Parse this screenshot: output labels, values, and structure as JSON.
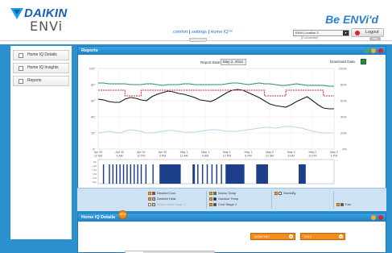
{
  "header": {
    "brand_daikin": "DAIKIN",
    "brand_envi": "ENVi",
    "brand_right": "Be ENVi'd",
    "nav": {
      "comfort": "comfort",
      "sep1": " | ",
      "settings": "settings",
      "sep2": " | ",
      "home_iq": "Home IQ™"
    },
    "zone_select": "ENVi Location 3",
    "zone_sub": "(2 connected)",
    "logout": "Logout",
    "help": "help"
  },
  "sidebar": {
    "items": [
      {
        "label": "Home IQ Details"
      },
      {
        "label": "Home IQ Insights"
      },
      {
        "label": "Reports"
      }
    ]
  },
  "reports": {
    "title": "Reports",
    "report_date_label": "Report Date:",
    "report_date_value": "May 2, 2013",
    "download_label": "Download Data"
  },
  "chart_data": {
    "type": "line",
    "x_ticks": [
      "Apr 30\n12 AM",
      "Apr 30\n6 AM",
      "Apr 30\n12 PM",
      "Apr 30\n6 PM",
      "May 1\n12 AM",
      "May 1\n6 AM",
      "May 1\n12 PM",
      "May 1\n6 PM",
      "May 2\n12 AM",
      "May 2\n6 AM",
      "May 2\n12 PM",
      "May 2\n6 PM"
    ],
    "y_left_ticks": [
      "100°",
      "80°",
      "60°",
      "40°",
      "20°",
      "0°"
    ],
    "y_right_ticks": [
      "100%",
      "80%",
      "60%",
      "40%",
      "20%",
      "0%"
    ],
    "ylim": [
      0,
      100
    ],
    "series": [
      {
        "name": "Outdoor Temp",
        "color": "#1a1a1a",
        "values": [
          62,
          61,
          59,
          58,
          58,
          62,
          64,
          63,
          61,
          60,
          65,
          68,
          70,
          72,
          71,
          69,
          68,
          66,
          64,
          61,
          60,
          59,
          62,
          66,
          70,
          73,
          74,
          73,
          70,
          67,
          64,
          60,
          56,
          54,
          53,
          52,
          55,
          59,
          62,
          65,
          60,
          55,
          51,
          50,
          50
        ]
      },
      {
        "name": "Indoor Temp",
        "color": "#2e8b7a",
        "values": [
          82,
          82,
          81,
          81,
          81,
          81,
          80,
          80,
          80,
          81,
          81,
          80,
          79,
          80,
          80,
          80,
          81,
          81,
          80,
          80,
          80,
          80,
          80,
          80,
          81,
          82,
          82,
          81,
          80,
          81,
          82,
          81,
          81,
          80,
          79,
          79,
          80,
          81,
          80,
          79,
          79,
          79,
          79,
          78,
          78
        ]
      },
      {
        "name": "Desired Cool",
        "color": "#d42f2f",
        "values": [
          73,
          73,
          73,
          73,
          73,
          66,
          66,
          66,
          73,
          73,
          73,
          73,
          73,
          73,
          73,
          73,
          73,
          73,
          73,
          73,
          73,
          73,
          73,
          73,
          73,
          73,
          73,
          73,
          73,
          73,
          73,
          66,
          66,
          66,
          66,
          73,
          73,
          73,
          73,
          73,
          73,
          73,
          66,
          66,
          66
        ]
      },
      {
        "name": "Humidity",
        "color": "#b9d3ee",
        "values": [
          20,
          21,
          22,
          21,
          20,
          22,
          24,
          23,
          22,
          20,
          20,
          21,
          22,
          23,
          23,
          22,
          21,
          21,
          21,
          22,
          23,
          24,
          24,
          23,
          22,
          22,
          22,
          23,
          24,
          25,
          26,
          27,
          27,
          26,
          27,
          28,
          28,
          27,
          26,
          24,
          22,
          21,
          20,
          20,
          20
        ]
      }
    ],
    "bottom_ticks": [
      "Htr",
      "Ht2",
      "Ht1",
      "Cl2",
      "Cl1",
      "Fan"
    ]
  },
  "legend": {
    "items": [
      {
        "label": "Desired Cool",
        "checked": true,
        "color": "#d42f2f",
        "dim": false
      },
      {
        "label": "Desired Heat",
        "checked": true,
        "color": "#e8a0a0",
        "dim": false
      },
      {
        "label": "Indoor Heat Stage 1",
        "checked": false,
        "color": "#f6c7a0",
        "dim": true
      },
      {
        "label": "Indoor Temp",
        "checked": true,
        "color": "#2e8b7a",
        "dim": false
      },
      {
        "label": "Outdoor Temp",
        "checked": true,
        "color": "#1a1a1a",
        "dim": false
      },
      {
        "label": "Cool Stage 1",
        "checked": true,
        "color": "#1d3f8a",
        "dim": false
      },
      {
        "label": "Humidity",
        "checked": true,
        "color": "#ffffff",
        "dim": false
      },
      {
        "label": "Fan",
        "checked": true,
        "color": "#555555",
        "dim": false
      }
    ]
  },
  "details": {
    "title": "Home IQ Details",
    "badge": "NEW",
    "dropdown1": "MONTHLY",
    "dropdown2": "2013"
  },
  "colors": {
    "panel_blue": "#2c8fce",
    "header_blue": "#1f7fc3",
    "accent_orange": "#f28c1e"
  }
}
